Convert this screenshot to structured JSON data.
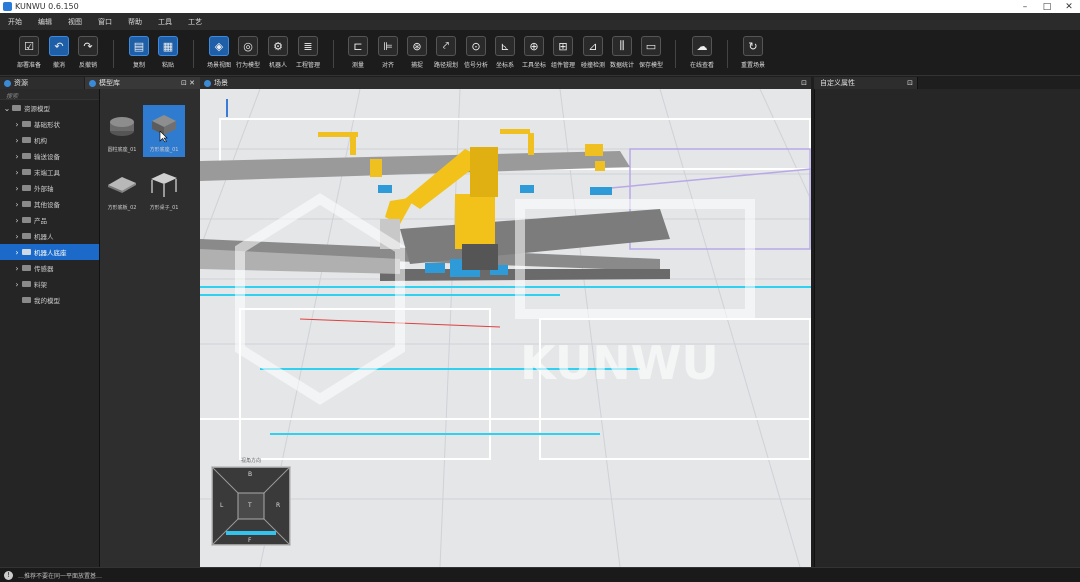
{
  "app": {
    "title": "KUNWU 0.6.150"
  },
  "menu": [
    "开始",
    "编辑",
    "视图",
    "窗口",
    "帮助",
    "工具",
    "工艺"
  ],
  "toolbar": [
    {
      "label": "部署准备",
      "icon": "checkbox-icon"
    },
    {
      "label": "撤消",
      "icon": "undo-icon"
    },
    {
      "label": "反撤销",
      "icon": "redo-icon"
    },
    {
      "label": "复制",
      "icon": "copy-icon"
    },
    {
      "label": "粘贴",
      "icon": "paste-icon"
    },
    {
      "label": "场景视图",
      "icon": "cube-icon"
    },
    {
      "label": "行为模型",
      "icon": "target-icon"
    },
    {
      "label": "机器人",
      "icon": "robot-icon"
    },
    {
      "label": "工程管理",
      "icon": "list-icon"
    },
    {
      "label": "测量",
      "icon": "measure-icon"
    },
    {
      "label": "对齐",
      "icon": "align-icon"
    },
    {
      "label": "捕捉",
      "icon": "snap-icon"
    },
    {
      "label": "路径规划",
      "icon": "path-icon"
    },
    {
      "label": "信号分析",
      "icon": "signal-icon"
    },
    {
      "label": "坐标系",
      "icon": "axis-icon"
    },
    {
      "label": "工具坐标",
      "icon": "crosshair-icon"
    },
    {
      "label": "组件管理",
      "icon": "component-icon"
    },
    {
      "label": "碰撞检测",
      "icon": "collision-icon"
    },
    {
      "label": "数据统计",
      "icon": "chart-icon"
    },
    {
      "label": "保存模型",
      "icon": "save-icon"
    },
    {
      "label": "在线查看",
      "icon": "cloud-icon"
    },
    {
      "label": "重置场景",
      "icon": "refresh-icon"
    }
  ],
  "panels": {
    "tree": "资源",
    "library": "模型库",
    "scene": "场景",
    "props": "自定义属性"
  },
  "tree": {
    "search": "搜索",
    "root": "资源模型",
    "items": [
      "基础形状",
      "机构",
      "输送设备",
      "末端工具",
      "外部轴",
      "其他设备",
      "产品",
      "机器人",
      "机器人底座",
      "传感器",
      "料架"
    ],
    "selected_index": 8,
    "last": "我的模型"
  },
  "library": [
    {
      "label": "圆柱底座_01"
    },
    {
      "label": "方形底座_01"
    },
    {
      "label": "方形底板_02"
    },
    {
      "label": "方形桌子_01"
    }
  ],
  "nav": {
    "title": "视角方向",
    "top": "B",
    "left": "L",
    "right": "R",
    "front": "F",
    "center": "T"
  },
  "watermark": {
    "text": "KUNWU"
  },
  "status": {
    "text": "…推荐不要在同一平面放置基…"
  }
}
